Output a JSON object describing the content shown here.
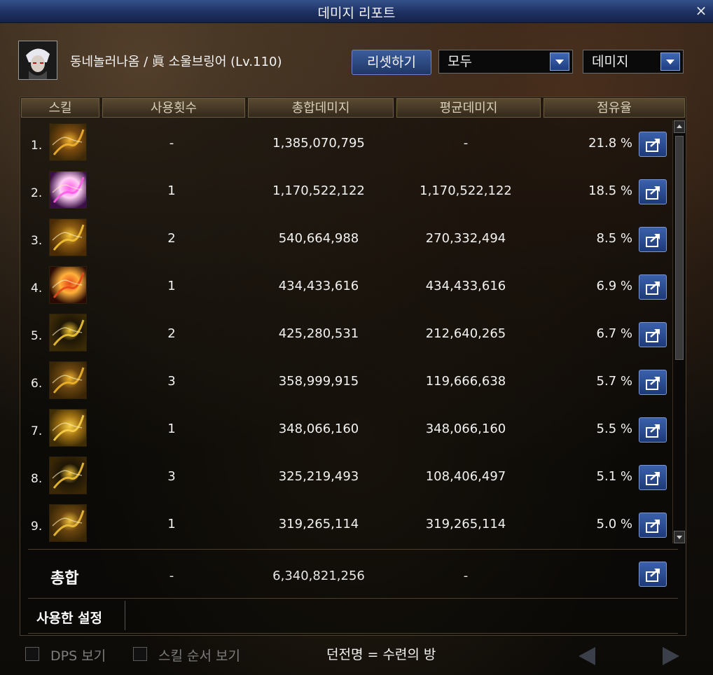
{
  "window": {
    "title": "데미지 리포트",
    "close_icon": "×"
  },
  "player": {
    "name_line": "동네놀러나옴 / 眞 소울브링어 (Lv.110)"
  },
  "controls": {
    "reset_label": "리셋하기",
    "filter_value": "모두",
    "type_value": "데미지"
  },
  "table": {
    "headers": [
      "스킬",
      "사용횟수",
      "총합데미지",
      "평균데미지",
      "점유율"
    ],
    "rows": [
      {
        "index": "1.",
        "uses": "-",
        "total": "1,385,070,795",
        "avg": "-",
        "share": "21.8 %",
        "icon_colors": [
          "#3d2a08",
          "#f3b32f",
          "#7a4a0f"
        ]
      },
      {
        "index": "2.",
        "uses": "1",
        "total": "1,170,522,122",
        "avg": "1,170,522,122",
        "share": "18.5 %",
        "icon_colors": [
          "#3a0f45",
          "#ff5be8",
          "#ffd0f5"
        ]
      },
      {
        "index": "3.",
        "uses": "2",
        "total": "540,664,988",
        "avg": "270,332,494",
        "share": "8.5 %",
        "icon_colors": [
          "#4a2b06",
          "#f5c436",
          "#8a5a10"
        ]
      },
      {
        "index": "4.",
        "uses": "1",
        "total": "434,433,616",
        "avg": "434,433,616",
        "share": "6.9 %",
        "icon_colors": [
          "#2a0b04",
          "#e34818",
          "#ffb03a"
        ]
      },
      {
        "index": "5.",
        "uses": "2",
        "total": "425,280,531",
        "avg": "212,640,265",
        "share": "6.7 %",
        "icon_colors": [
          "#3a2a06",
          "#f2c531",
          "#1e1606"
        ]
      },
      {
        "index": "6.",
        "uses": "3",
        "total": "358,999,915",
        "avg": "119,666,638",
        "share": "5.7 %",
        "icon_colors": [
          "#3a2606",
          "#f0b42a",
          "#6a4510"
        ]
      },
      {
        "index": "7.",
        "uses": "1",
        "total": "348,066,160",
        "avg": "348,066,160",
        "share": "5.5 %",
        "icon_colors": [
          "#3f2d06",
          "#f9d24a",
          "#a57514"
        ]
      },
      {
        "index": "8.",
        "uses": "3",
        "total": "325,219,493",
        "avg": "108,406,497",
        "share": "5.1 %",
        "icon_colors": [
          "#3a2706",
          "#f2c234",
          "#1e1606"
        ]
      },
      {
        "index": "9.",
        "uses": "1",
        "total": "319,265,114",
        "avg": "319,265,114",
        "share": "5.0 %",
        "icon_colors": [
          "#3a2706",
          "#f0c03a",
          "#6a4510"
        ]
      }
    ]
  },
  "summary": {
    "label": "총합",
    "uses": "-",
    "total": "6,340,821,256",
    "avg": "-"
  },
  "settings": {
    "label": "사용한 설정"
  },
  "footer": {
    "dps_label": "DPS 보기",
    "order_label": "스킬 순서 보기",
    "dungeon_text": "던전명 = 수련의 방"
  },
  "colors": {
    "accent_blue": "#1f3766",
    "title_bar": "#1c2f5e",
    "header_gold": "#5a4a32"
  }
}
